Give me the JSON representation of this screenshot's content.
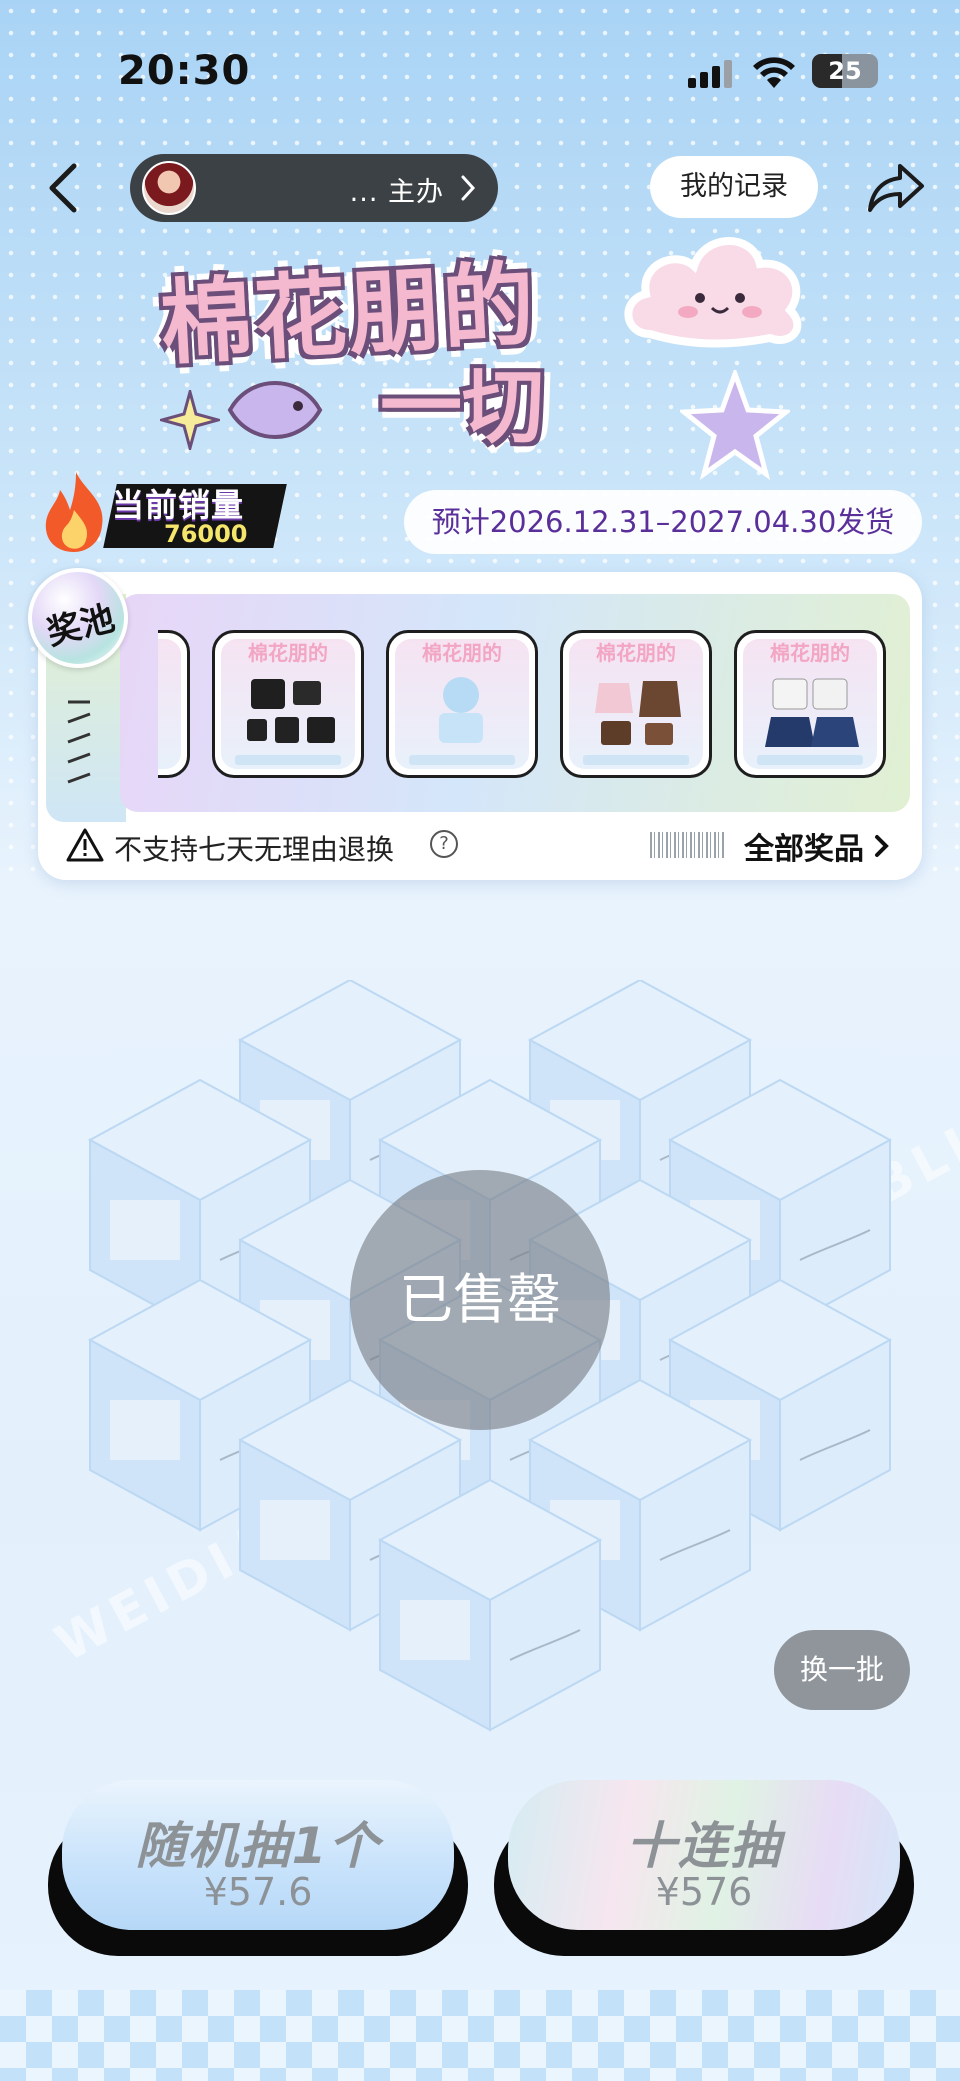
{
  "status_bar": {
    "time": "20:30",
    "battery": "25"
  },
  "header": {
    "host_text": "... 主办",
    "record_label": "我的记录"
  },
  "title_art": {
    "line1": "棉花朋的",
    "line2": "一切"
  },
  "sales": {
    "label": "当前销量",
    "value": "76000"
  },
  "shipping": "预计2026.12.31–2027.04.30发货",
  "prize_pool": {
    "badge": "奖池",
    "prize_card_title": "棉花朋的",
    "notice": "不支持七天无理由退换",
    "help": "?",
    "all_prizes_label": "全部奖品"
  },
  "boxes": {
    "sold_out_label": "已售罄",
    "refresh_label": "换一批",
    "watermark": "WEIDIAN BLIND BOX"
  },
  "draw": {
    "single": {
      "title": "随机抽1个",
      "price": "¥57.6"
    },
    "ten": {
      "title": "十连抽",
      "price": "¥576"
    }
  },
  "colors": {
    "accent_purple": "#5a2f9a",
    "sold_out_overlay": "#787d84",
    "draw_text": "#8d9297"
  }
}
